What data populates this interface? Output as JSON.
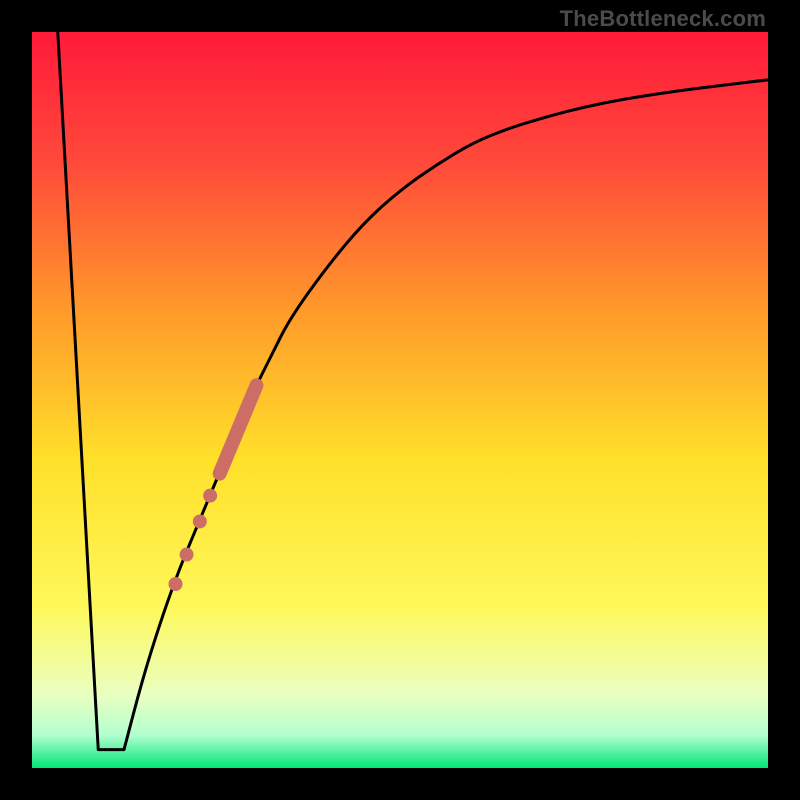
{
  "watermark": {
    "text": "TheBottleneck.com"
  },
  "chart_data": {
    "type": "line",
    "title": "",
    "xlabel": "",
    "ylabel": "",
    "xlim": [
      0,
      100
    ],
    "ylim": [
      0,
      100
    ],
    "grid": false,
    "legend": false,
    "background_gradient": {
      "stops": [
        {
          "pos": 0.0,
          "color": "#ff1a3a"
        },
        {
          "pos": 0.18,
          "color": "#ff4a3a"
        },
        {
          "pos": 0.38,
          "color": "#ff9a2a"
        },
        {
          "pos": 0.58,
          "color": "#ffe02a"
        },
        {
          "pos": 0.78,
          "color": "#fff85a"
        },
        {
          "pos": 0.9,
          "color": "#eaffc0"
        },
        {
          "pos": 0.955,
          "color": "#b3ffd0"
        },
        {
          "pos": 1.0,
          "color": "#00e676"
        }
      ]
    },
    "series": [
      {
        "name": "left-falling-line",
        "x": [
          3.5,
          9.0
        ],
        "y": [
          100,
          2.5
        ]
      },
      {
        "name": "valley-floor",
        "x": [
          9.0,
          12.5
        ],
        "y": [
          2.5,
          2.5
        ]
      },
      {
        "name": "rising-curve",
        "x": [
          12.5,
          15,
          17.5,
          20,
          22.5,
          25,
          27.5,
          30,
          32.5,
          35,
          40,
          45,
          50,
          55,
          60,
          65,
          70,
          75,
          80,
          85,
          90,
          95,
          100
        ],
        "y": [
          2.5,
          12,
          20,
          27,
          33,
          39,
          45,
          51,
          56,
          61,
          68,
          74,
          78.5,
          82,
          85,
          87,
          88.5,
          89.8,
          90.8,
          91.6,
          92.3,
          92.9,
          93.5
        ]
      }
    ],
    "markers": [
      {
        "name": "thick-segment",
        "type": "segment",
        "x": [
          25.5,
          30.5
        ],
        "y": [
          40,
          52
        ],
        "stroke_width": 14,
        "color": "#cc6e66"
      },
      {
        "name": "dot-1",
        "type": "dot",
        "x": 24.2,
        "y": 37.0,
        "r": 7,
        "color": "#cc6e66"
      },
      {
        "name": "dot-2",
        "type": "dot",
        "x": 22.8,
        "y": 33.5,
        "r": 7,
        "color": "#cc6e66"
      },
      {
        "name": "dot-3",
        "type": "dot",
        "x": 21.0,
        "y": 29.0,
        "r": 7,
        "color": "#cc6e66"
      },
      {
        "name": "dot-4",
        "type": "dot",
        "x": 19.5,
        "y": 25.0,
        "r": 7,
        "color": "#cc6e66"
      }
    ]
  }
}
